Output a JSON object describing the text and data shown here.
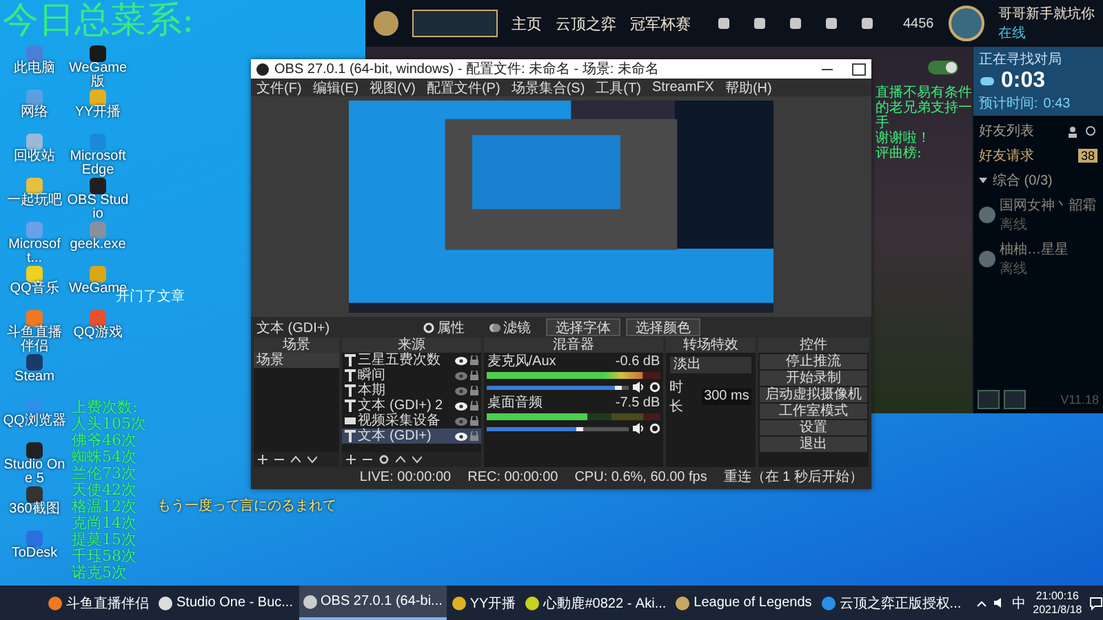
{
  "overlay_title": "今日总菜系:",
  "desktop_icons": [
    {
      "label": "此电脑",
      "color": "#4a7fd8"
    },
    {
      "label": "网络",
      "color": "#5aa0e0"
    },
    {
      "label": "回收站",
      "color": "#9ab8d8"
    },
    {
      "label": "一起玩吧",
      "color": "#e8c040"
    },
    {
      "label": "Microsoft...",
      "color": "#6aa0e8"
    },
    {
      "label": "QQ音乐",
      "color": "#f0d020"
    },
    {
      "label": "斗鱼直播伴侣",
      "color": "#f07820"
    },
    {
      "label": "Steam",
      "color": "#1b3a6a"
    },
    {
      "label": "QQ浏览器",
      "color": "#2a90e8"
    },
    {
      "label": "Studio One 5",
      "color": "#222222"
    },
    {
      "label": "360截图",
      "color": "#333333"
    },
    {
      "label": "ToDesk",
      "color": "#2a70e0"
    },
    {
      "label": "WeGame版",
      "color": "#1a1a1a"
    },
    {
      "label": "YY开播",
      "color": "#e0b020"
    },
    {
      "label": "Microsoft Edge",
      "color": "#1a8ad8"
    },
    {
      "label": "OBS Studio",
      "color": "#202020"
    },
    {
      "label": "geek.exe",
      "color": "#8890a0"
    },
    {
      "label": "WeGame",
      "color": "#d8a818"
    },
    {
      "label": "QQ游戏",
      "color": "#e85030"
    }
  ],
  "desktop_note": "开门了文章",
  "lyric": "もう一度って言にのるまれて",
  "counter": {
    "heading": "上费次数:",
    "lines": [
      "人头105次",
      "佛爷46次",
      "蜘蛛54次",
      "兰伦73次",
      "天使42次",
      "格温12次",
      "克尚14次",
      "提莫15次",
      "千珏58次",
      "诺克5次"
    ]
  },
  "support_note": [
    "直播不易有条件的老兄弟支持一手",
    "谢谢啦！",
    "评曲榜:"
  ],
  "game_client": {
    "nav": [
      "主页",
      "云顶之弈",
      "冠军杯赛"
    ],
    "currency": "4456",
    "player_name": "哥哥新手就坑你",
    "player_status": "在线",
    "queue": {
      "heading": "正在寻找对局",
      "time": "0:03",
      "estimate_label": "预计时间:",
      "estimate": "0:43"
    },
    "friends_title": "好友列表",
    "requests": "好友请求",
    "requests_count": "38",
    "group": "综合 (0/3)",
    "friends": [
      {
        "name": "国网女神丶韶霜",
        "status": "离线"
      },
      {
        "name": "柚柚…星星",
        "status": "离线"
      }
    ],
    "version": "V11.18",
    "mode_toggle": {
      "on": true
    }
  },
  "obs": {
    "title": "OBS 27.0.1 (64-bit, windows) - 配置文件: 未命名 - 场景: 未命名",
    "menu": [
      "文件(F)",
      "编辑(E)",
      "视图(V)",
      "配置文件(P)",
      "场景集合(S)",
      "工具(T)",
      "StreamFX",
      "帮助(H)"
    ],
    "source_label": "文本 (GDI+)",
    "source_buttons": [
      {
        "label": "属性",
        "kind": "gear"
      },
      {
        "label": "滤镜",
        "kind": "filter"
      },
      {
        "label": "选择字体",
        "kind": "plain"
      },
      {
        "label": "选择颜色",
        "kind": "plain"
      }
    ],
    "docks": {
      "scenes": "场景",
      "sources": "来源",
      "mixer": "混音器",
      "transitions": "转场特效",
      "controls": "控件"
    },
    "scenes": [
      {
        "name": "场景",
        "selected": true
      }
    ],
    "sources": [
      {
        "name": "三星五费次数",
        "kind": "text",
        "visible": true,
        "selected": false
      },
      {
        "name": "瞬间",
        "kind": "text",
        "visible": false,
        "selected": false
      },
      {
        "name": "本期",
        "kind": "text",
        "visible": false,
        "selected": false
      },
      {
        "name": "文本 (GDI+) 2",
        "kind": "text",
        "visible": true,
        "selected": false
      },
      {
        "name": "视频采集设备",
        "kind": "video",
        "visible": false,
        "selected": false
      },
      {
        "name": "文本 (GDI+)",
        "kind": "text",
        "visible": true,
        "selected": true
      }
    ],
    "mixer": [
      {
        "name": "麦克风/Aux",
        "reading": "-0.6 dB",
        "meter": {
          "level": 0.9
        },
        "fader": {
          "level": 0.95
        }
      },
      {
        "name": "桌面音频",
        "reading": "-7.5 dB",
        "meter": {
          "level": 0.58
        },
        "fader": {
          "level": 0.68
        }
      }
    ],
    "transition": {
      "value": "淡出",
      "duration_label": "时长",
      "duration": "300 ms"
    },
    "controls": [
      "停止推流",
      "开始录制",
      "启动虚拟摄像机",
      "工作室模式",
      "设置",
      "退出"
    ],
    "status": {
      "live": "LIVE: 00:00:00",
      "rec": "REC: 00:00:00",
      "cpu": "CPU: 0.6%, 60.00 fps",
      "reconnect": "重连（在 1 秒后开始）"
    }
  },
  "taskbar": {
    "items": [
      {
        "label": "斗鱼直播伴侣",
        "color": "#f07820",
        "selected": false
      },
      {
        "label": "Studio One - Buc...",
        "color": "#dddddd",
        "selected": false
      },
      {
        "label": "OBS 27.0.1 (64-bi...",
        "color": "#cccccc",
        "selected": true
      },
      {
        "label": "YY开播",
        "color": "#e0b020",
        "selected": false
      },
      {
        "label": "心動鹿#0822 - Aki...",
        "color": "#c8d020",
        "selected": false
      },
      {
        "label": "League of Legends",
        "color": "#c8a860",
        "selected": false
      },
      {
        "label": "云顶之弈正版授权...",
        "color": "#2a90e8",
        "selected": false
      }
    ],
    "ime": "中",
    "time": "21:00:16",
    "date": "2021/8/18"
  }
}
